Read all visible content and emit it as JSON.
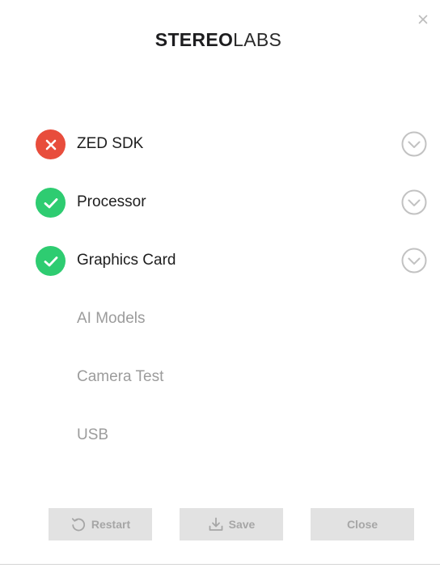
{
  "window": {
    "close_icon": "close-icon"
  },
  "logo": {
    "part_bold": "STEREO",
    "part_light": "LABS"
  },
  "checks": [
    {
      "label": "ZED SDK",
      "status": "fail",
      "icon": "cross-icon"
    },
    {
      "label": "Processor",
      "status": "pass",
      "icon": "check-icon"
    },
    {
      "label": "Graphics Card",
      "status": "pass",
      "icon": "check-icon"
    },
    {
      "label": "AI Models",
      "status": "pending"
    },
    {
      "label": "Camera Test",
      "status": "pending"
    },
    {
      "label": "USB",
      "status": "pending"
    }
  ],
  "buttons": {
    "restart_label": "Restart",
    "save_label": "Save",
    "close_label": "Close"
  },
  "colors": {
    "fail": "#e84d3c",
    "pass": "#2ecc71",
    "pending_text": "#9c9c9c",
    "button_bg": "#e2e2e2",
    "button_text": "#a6a6a6"
  }
}
